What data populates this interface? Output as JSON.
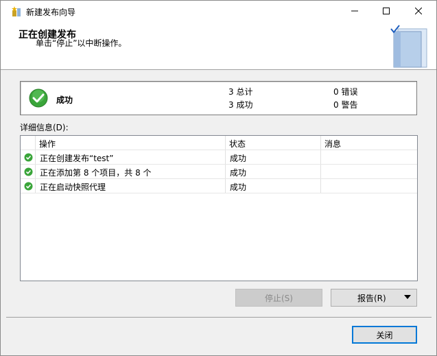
{
  "window": {
    "title": "新建发布向导"
  },
  "header": {
    "title": "正在创建发布",
    "subtitle": "单击“停止”以中断操作。"
  },
  "status": {
    "label": "成功",
    "total": "3 总计",
    "success": "3 成功",
    "errors": "0 错误",
    "warnings": "0 警告"
  },
  "details": {
    "label": "详细信息(D):",
    "columns": [
      "操作",
      "状态",
      "消息"
    ],
    "rows": [
      {
        "action": "正在创建发布“test”",
        "status": "成功",
        "message": ""
      },
      {
        "action": "正在添加第 8 个项目，共 8 个",
        "status": "成功",
        "message": ""
      },
      {
        "action": "正在启动快照代理",
        "status": "成功",
        "message": ""
      }
    ]
  },
  "buttons": {
    "stop": "停止(S)",
    "report": "报告(R)",
    "close": "关闭"
  },
  "colors": {
    "success": "#2ea043",
    "accent": "#0078d7"
  }
}
